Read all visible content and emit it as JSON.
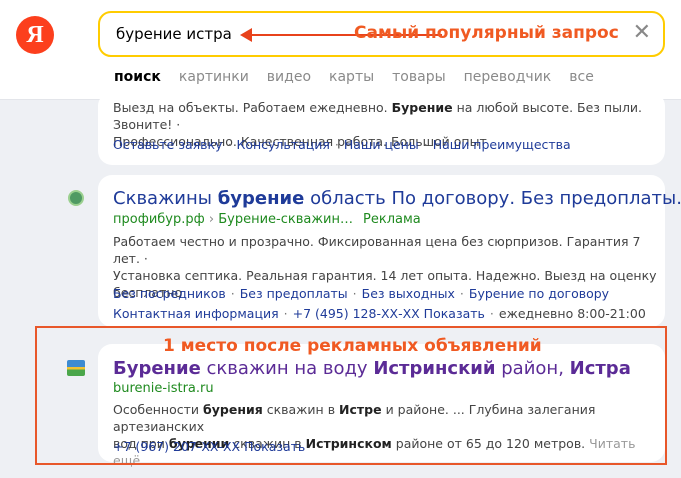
{
  "header": {
    "logo": "Я",
    "search_value": "бурение истра",
    "annotation": "Самый популярный запрос",
    "clear_symbol": "✕",
    "tabs": [
      "поиск",
      "картинки",
      "видео",
      "карты",
      "товары",
      "переводчик",
      "все"
    ]
  },
  "result1": {
    "line1_a": "Выезд на объекты. Работаем ежедневно. ",
    "line1_b": "Бурение",
    "line1_c": " на любой высоте. Без пыли. Звоните! ·",
    "line2": "Профессионально. Качественная работа. Большой опыт",
    "links": [
      "Оставьте заявку",
      "Консультация",
      "Наши цены",
      "Наши преимущества"
    ]
  },
  "result2": {
    "title_a": "Скважины ",
    "title_b": "бурение",
    "title_c": " область По договору. Без предоплаты.",
    "url": "профибур.рф",
    "url_sep": "›",
    "url_path": "Бурение-скважин…",
    "ad_label": "Реклама",
    "text1": "Работаем честно и прозрачно. Фиксированная цена без сюрпризов. Гарантия 7 лет. ·",
    "text2": "Установка септика. Реальная гарантия. 14 лет опыта. Надежно. Выезд на оценку",
    "text3": "бесплатно",
    "links": [
      "Без посредников",
      "Без предоплаты",
      "Без выходных",
      "Бурение по договору"
    ],
    "contact": "Контактная информация",
    "phone": "+7 (495) 128-ХХ-ХХ Показать",
    "hours": "ежедневно 8:00-21:00"
  },
  "annotation_bottom": "1 место после рекламных объявлений",
  "result3": {
    "title_a": "Бурение",
    "title_b": " скважин на воду ",
    "title_c": "Истринский",
    "title_d": " район, ",
    "title_e": "Истра",
    "url": "burenie-istra.ru",
    "t1_a": "Особенности ",
    "t1_b": "бурения",
    "t1_c": " скважин в ",
    "t1_d": "Истре",
    "t1_e": " и районе. ... Глубина залегания артезианских",
    "t2_a": "вод при ",
    "t2_b": "бурении",
    "t2_c": " скважин в ",
    "t2_d": "Истринском",
    "t2_e": " районе от 65 до 120 метров.",
    "read_more": "Читать ещё",
    "phone": "+7 (967) 207-ХХ-ХХ Показать"
  }
}
